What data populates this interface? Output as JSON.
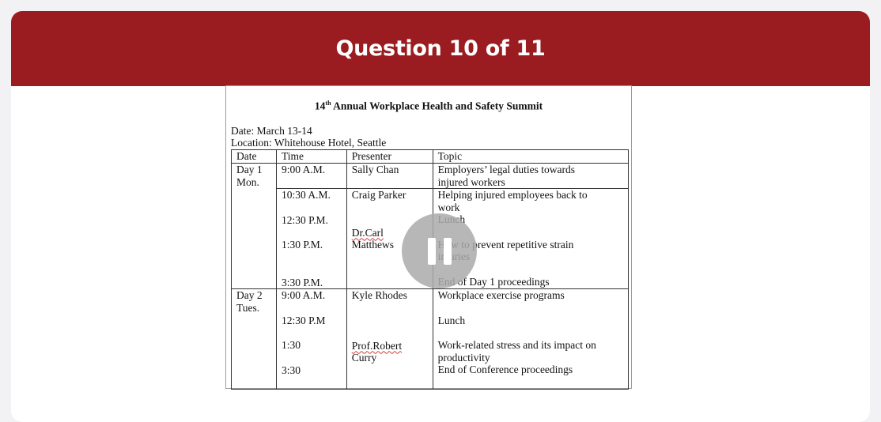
{
  "header": {
    "title": "Question 10 of 11"
  },
  "doc": {
    "title_num": "14",
    "title_sup": "th",
    "title_rest": " Annual Workplace Health and Safety Summit",
    "date_line": "Date: March 13-14",
    "location_line": "Location: Whitehouse Hotel, Seattle",
    "columns": [
      "Date",
      "Time",
      "Presenter",
      "Topic"
    ],
    "day1": {
      "date1": "Day 1",
      "date2": "Mon.",
      "times": [
        "9:00 A.M.",
        "10:30 A.M.",
        "12:30 P.M.",
        "1:30 P.M.",
        "3:30 P.M."
      ],
      "presenters": [
        "Sally Chan",
        "Craig Parker",
        "Dr.Carl",
        "Matthews"
      ],
      "topics": [
        "Employers’ legal duties towards",
        "injured workers",
        "Helping injured employees back to",
        "work",
        "Lunch",
        "How to prevent repetitive strain",
        "injuries",
        "End of Day 1 proceedings"
      ]
    },
    "day2": {
      "date1": "Day 2",
      "date2": "Tues.",
      "times": [
        "9:00 A.M.",
        "12:30 P.M",
        "1:30",
        "3:30"
      ],
      "presenters": [
        "Kyle Rhodes",
        "Prof.Robert",
        "Curry"
      ],
      "topics": [
        "Workplace exercise programs",
        "Lunch",
        "Work-related stress and its impact on",
        "productivity",
        "End of Conference proceedings"
      ]
    }
  },
  "media": {
    "pause_icon": "pause-icon"
  }
}
